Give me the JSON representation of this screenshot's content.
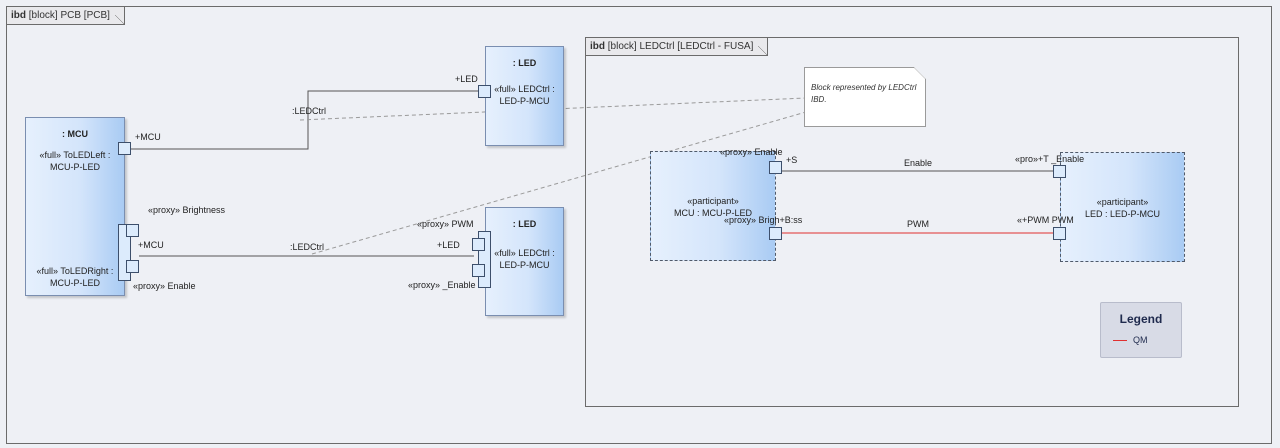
{
  "frames": {
    "outer": {
      "kind": "ibd",
      "label": "[block] PCB [PCB]"
    },
    "inner": {
      "kind": "ibd",
      "label": "[block] LEDCtrl [LEDCtrl - FUSA]"
    }
  },
  "blocks": {
    "mcu": {
      "name": ": MCU",
      "part_left": "«full» ToLEDLeft : MCU-P-LED",
      "part_right": "«full» ToLEDRight : MCU-P-LED"
    },
    "led_top": {
      "name": ": LED",
      "part": "«full» LEDCtrl : LED-P-MCU"
    },
    "led_bottom": {
      "name": ": LED",
      "part": "«full» LEDCtrl : LED-P-MCU"
    },
    "participant_mcu": {
      "stereotype": "«participant»",
      "name": "MCU : MCU-P-LED"
    },
    "participant_led": {
      "stereotype": "«participant»",
      "name": "LED : LED-P-MCU"
    }
  },
  "labels": {
    "mcu_port_top": "+MCU",
    "mcu_brightness": "«proxy» Brightness",
    "mcu_port_bottom": "+MCU",
    "mcu_enable": "«proxy» Enable",
    "led_top_port": "+LED",
    "led_bottom_pwm": "«proxy» PWM",
    "led_bottom_port": "+LED",
    "led_bottom_enable": "«proxy» _Enable",
    "conn_top": ":LEDCtrl",
    "conn_bottom": ":LEDCtrl",
    "inner_proxy_enable": "«proxy» Enable",
    "inner_plus_s": "+S",
    "inner_proxy_brightness": "«proxy» Brigh+B:ss",
    "inner_enable_line": "Enable",
    "inner_pwm_line": "PWM",
    "inner_right_top": "«pro»+T _Enable",
    "inner_right_bottom": "«+PWM  PWM"
  },
  "note": {
    "text": "Block represented by LEDCtrl IBD."
  },
  "legend": {
    "title": "Legend",
    "items": [
      {
        "label": "QM",
        "color": "#e03030"
      }
    ]
  },
  "colors": {
    "block_fill_light": "#e6f0fd",
    "block_fill_dark": "#a9cbf3",
    "qm_line": "#e03030",
    "connector": "#555555"
  }
}
